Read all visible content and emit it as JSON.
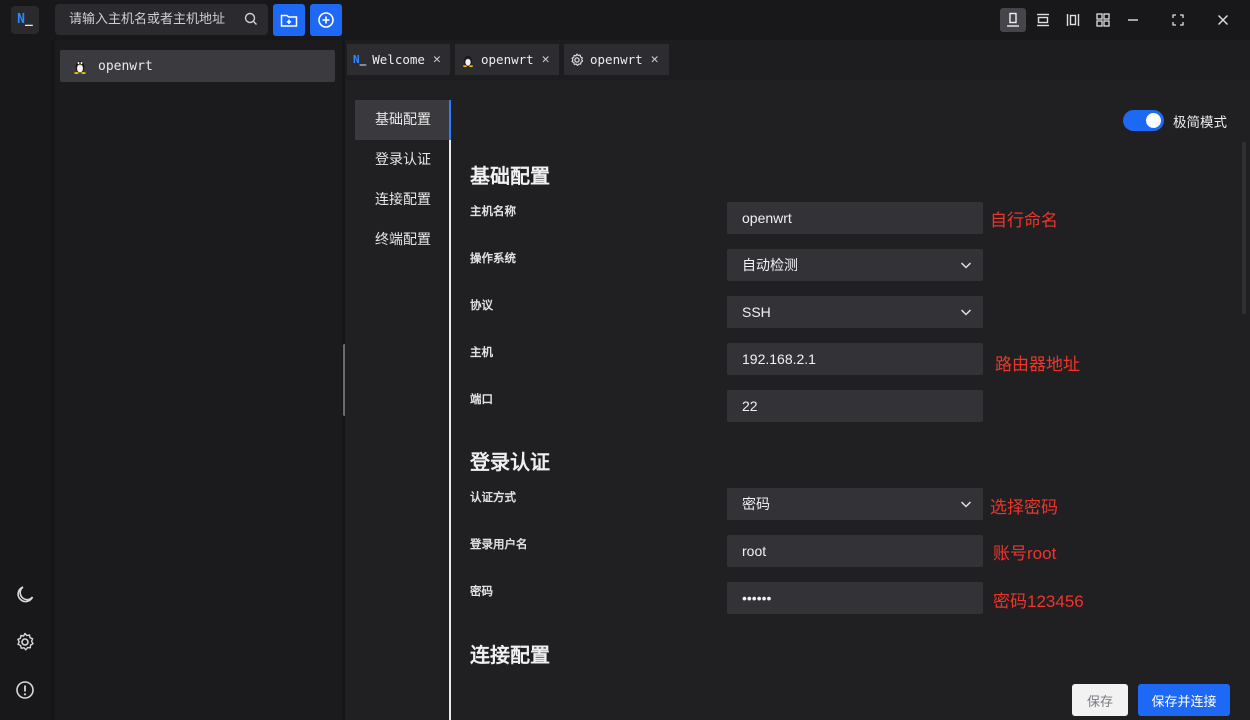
{
  "app": {
    "logo_text": "N",
    "logo_cursor": "_"
  },
  "search": {
    "placeholder": "请输入主机名或者主机地址",
    "value": ""
  },
  "hosts": [
    {
      "name": "openwrt",
      "icon": "linux-tux-icon"
    }
  ],
  "tabs": [
    {
      "label": "Welcome",
      "icon": "app-logo-icon"
    },
    {
      "label": "openwrt",
      "icon": "linux-tux-icon"
    },
    {
      "label": "openwrt",
      "icon": "gear-icon"
    }
  ],
  "subnav": [
    "基础配置",
    "登录认证",
    "连接配置",
    "终端配置"
  ],
  "toggle": {
    "label": "极简模式",
    "on": true
  },
  "sections": {
    "basic": "基础配置",
    "auth": "登录认证",
    "conn": "连接配置"
  },
  "form": {
    "hostname": {
      "label": "主机名称",
      "value": "openwrt",
      "note": "自行命名"
    },
    "os": {
      "label": "操作系统",
      "value": "自动检测"
    },
    "protocol": {
      "label": "协议",
      "value": "SSH"
    },
    "host": {
      "label": "主机",
      "value": "192.168.2.1",
      "note": "路由器地址"
    },
    "port": {
      "label": "端口",
      "value": "22"
    },
    "auth_method": {
      "label": "认证方式",
      "value": "密码",
      "note": "选择密码"
    },
    "username": {
      "label": "登录用户名",
      "value": "root",
      "note": "账号root"
    },
    "password": {
      "label": "密码",
      "value": "••••••",
      "note": "密码123456"
    }
  },
  "buttons": {
    "save": "保存",
    "save_connect": "保存并连接"
  },
  "colors": {
    "accent": "#1d68f4",
    "note_red": "#f0342a",
    "background": "#202023"
  }
}
